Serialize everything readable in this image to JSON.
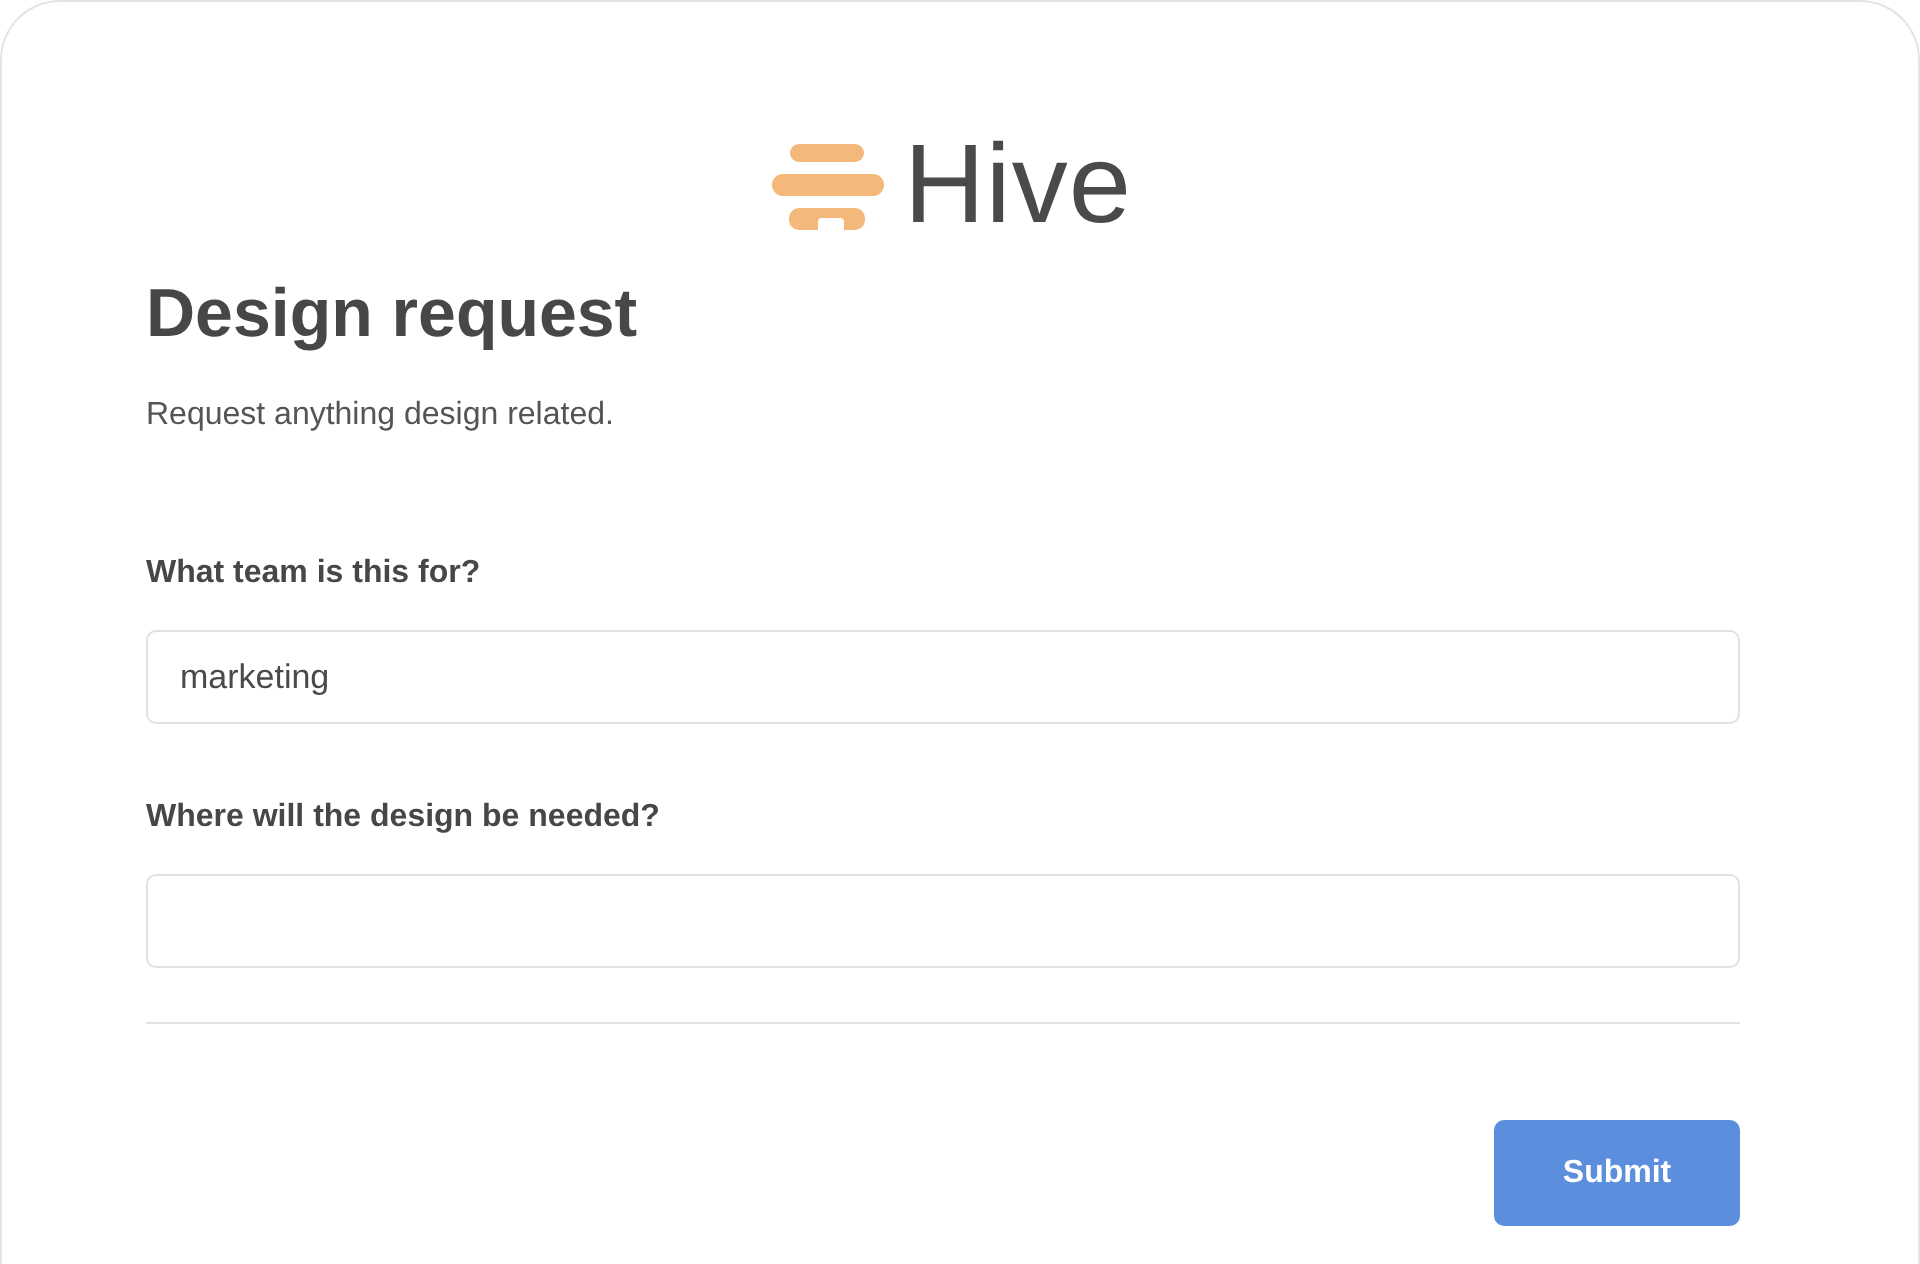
{
  "logo": {
    "name": "Hive"
  },
  "form": {
    "title": "Design request",
    "description": "Request anything design related.",
    "fields": [
      {
        "label": "What team is this for?",
        "value": "marketing"
      },
      {
        "label": "Where will the design be needed?"
      }
    ],
    "submit": {
      "label": "Submit"
    }
  }
}
